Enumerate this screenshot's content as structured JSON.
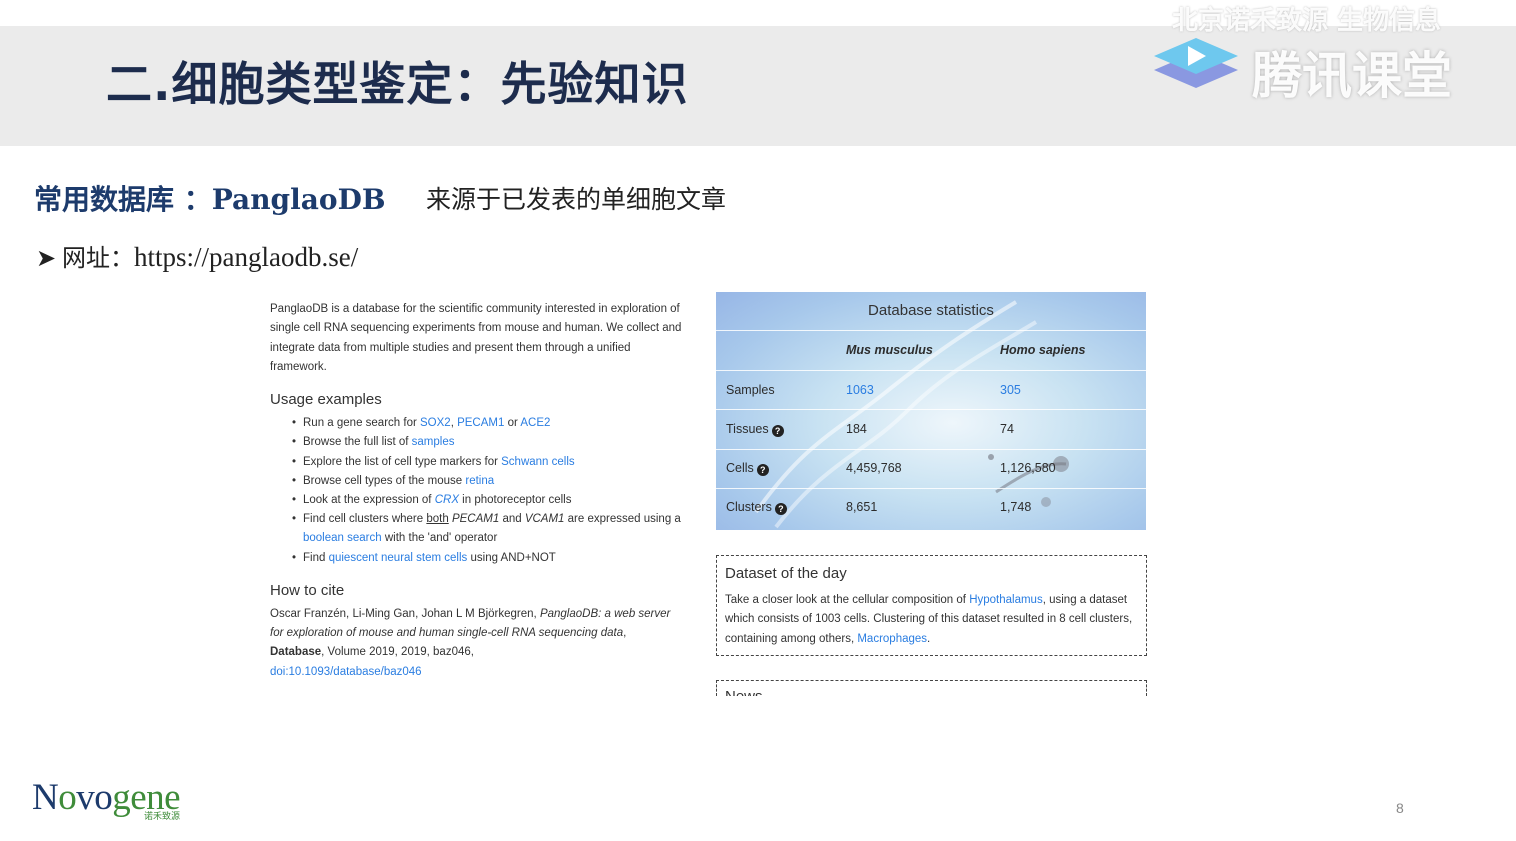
{
  "slide": {
    "title": "二.细胞类型鉴定：先验知识",
    "subheading_prefix": "常用数据库 ：",
    "subheading_db": "PanglaoDB",
    "source_note": "来源于已发表的单细胞文章",
    "url_label": "网址：",
    "url": "https://panglaodb.se/",
    "page_number": "8"
  },
  "watermark": {
    "top_text": "北京诺禾致源 生物信息",
    "brand": "腾讯课堂"
  },
  "panglao": {
    "intro": "PanglaoDB is a database for the scientific community interested in exploration of single cell RNA sequencing experiments from mouse and human. We collect and integrate data from multiple studies and present them through a unified framework.",
    "usage": {
      "heading": "Usage examples",
      "l1_text": "Run a gene search for ",
      "l1_link1": "SOX2",
      "l1_sep": ", ",
      "l1_link2": "PECAM1",
      "l1_or": " or ",
      "l1_link3": "ACE2",
      "l2_text": "Browse the full list of ",
      "l2_link": "samples",
      "l3_text": "Explore the list of cell type markers for ",
      "l3_link": "Schwann cells",
      "l4_text": "Browse cell types of the mouse ",
      "l4_link": "retina",
      "l5_text": "Look at the expression of ",
      "l5_link": "CRX",
      "l5_tail": " in photoreceptor cells",
      "l6_text": "Find cell clusters where ",
      "l6_both": "both",
      "l6_gene1": "PECAM1",
      "l6_and": " and ",
      "l6_gene2": "VCAM1",
      "l6_mid": " are expressed using a ",
      "l6_link": "boolean search",
      "l6_tail": " with the 'and' operator",
      "l7_text": "Find ",
      "l7_link": "quiescent neural stem cells",
      "l7_tail": " using AND+NOT"
    },
    "cite": {
      "heading": "How to cite",
      "authors": "Oscar Franzén, Li-Ming Gan, Johan L M Björkegren, ",
      "title": "PanglaoDB: a web server for exploration of mouse and human single-cell RNA sequencing data",
      "comma": ", ",
      "journal": "Database",
      "details": ", Volume 2019, 2019, baz046,",
      "doi": "doi:10.1093/database/baz046"
    },
    "stats": {
      "title": "Database statistics",
      "col_mouse": "Mus musculus",
      "col_human": "Homo sapiens",
      "help_icon": "?",
      "rows": [
        {
          "label": "Samples",
          "mouse": "1063",
          "human": "305"
        },
        {
          "label": "Tissues",
          "mouse": "184",
          "human": "74"
        },
        {
          "label": "Cells",
          "mouse": "4,459,768",
          "human": "1,126,580"
        },
        {
          "label": "Clusters",
          "mouse": "8,651",
          "human": "1,748"
        }
      ]
    },
    "dataset_of_day": {
      "heading": "Dataset of the day",
      "t1": "Take a closer look at the cellular composition of ",
      "link1": "Hypothalamus",
      "t2": ", using a dataset which consists of 1003 cells. Clustering of this dataset resulted in 8 cell clusters, containing among others, ",
      "link2": "Macrophages",
      "t3": "."
    },
    "news_heading": "News"
  },
  "logo": {
    "n": "N",
    "o": "o",
    "vo": "vo",
    "gene": "gene",
    "cn": "诺禾致源"
  },
  "colors": {
    "title": "#1d2c4d",
    "subhead": "#1d3b6c",
    "link": "#2a7de1",
    "logo_green": "#3f8c3a",
    "band": "#ebebeb"
  }
}
